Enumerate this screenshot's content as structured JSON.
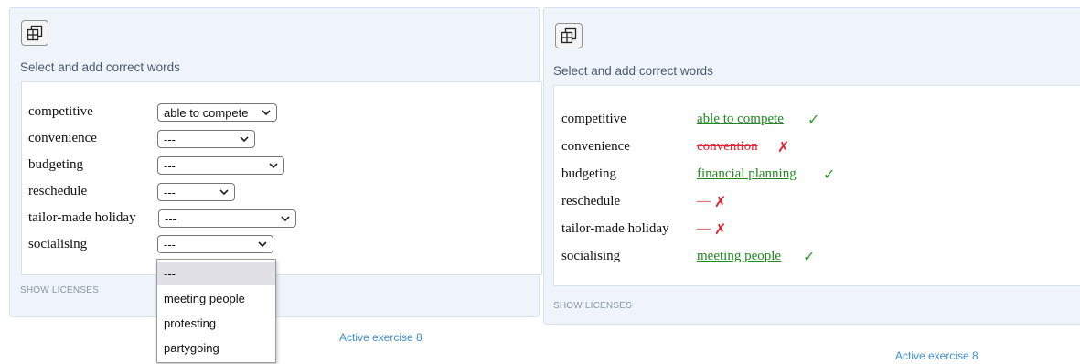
{
  "left": {
    "instruction": "Select and add correct words",
    "rows": [
      {
        "word": "competitive",
        "selected": "able to compete"
      },
      {
        "word": "convenience",
        "selected": "---"
      },
      {
        "word": "budgeting",
        "selected": "---"
      },
      {
        "word": "reschedule",
        "selected": "---"
      },
      {
        "word": "tailor-made holiday",
        "selected": "---"
      },
      {
        "word": "socialising",
        "selected": "---"
      }
    ],
    "dropdown_options": [
      "---",
      "meeting people",
      "protesting",
      "partygoing"
    ],
    "show_licenses": "SHOW LICENSES",
    "footer": "Active exercise 8"
  },
  "right": {
    "instruction": "Select and add correct words",
    "rows": [
      {
        "word": "competitive",
        "answer": "able to compete",
        "status": "correct",
        "mark": "✓"
      },
      {
        "word": "convenience",
        "answer": "convention",
        "status": "wrong",
        "mark": "✗"
      },
      {
        "word": "budgeting",
        "answer": "financial planning",
        "status": "correct",
        "mark": "✓"
      },
      {
        "word": "reschedule",
        "answer": "—",
        "status": "empty",
        "mark": "✗"
      },
      {
        "word": "tailor-made holiday",
        "answer": "—",
        "status": "empty",
        "mark": "✗"
      },
      {
        "word": "socialising",
        "answer": "meeting people",
        "status": "correct",
        "mark": "✓"
      }
    ],
    "show_licenses": "SHOW LICENSES",
    "footer": "Active exercise 8"
  },
  "icons": {
    "fullscreen": "window-restore-icon",
    "select_arrow": "chevron-down-icon",
    "correct": "check-icon",
    "wrong": "cross-icon"
  },
  "colors": {
    "correct": "#1e8a1e",
    "wrong": "#e0232c",
    "link": "#3d8fd1",
    "panel_bg": "#eef4fa"
  }
}
